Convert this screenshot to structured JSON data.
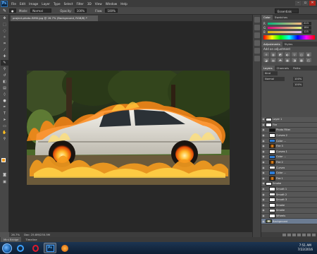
{
  "app": {
    "logo": "Ps",
    "menu": [
      "File",
      "Edit",
      "Image",
      "Layer",
      "Type",
      "Select",
      "Filter",
      "3D",
      "View",
      "Window",
      "Help"
    ],
    "window_controls": [
      "–",
      "▫",
      "✕"
    ]
  },
  "options_bar": {
    "mode_label": "Mode:",
    "mode_value": "Normal",
    "opacity_label": "Opacity:",
    "opacity_value": "100%",
    "flow_label": "Flow:",
    "flow_value": "100%",
    "workspace": "Essentials"
  },
  "document": {
    "tab_title": "project-photo-SIM0.jpg @ 26.7% (Background, RGB/8) *",
    "zoom": "26.7%",
    "doc_size": "Doc: 25.8M/230.5M"
  },
  "bottom_tabs": [
    "Mini Bridge",
    "Timeline"
  ],
  "color_panel": {
    "tabs": [
      "Color",
      "Swatches"
    ],
    "rows": [
      {
        "label": "R",
        "value": "223"
      },
      {
        "label": "G",
        "value": "184"
      },
      {
        "label": "B",
        "value": "125"
      }
    ]
  },
  "adjustments_panel": {
    "tabs": [
      "Adjustments",
      "Styles"
    ],
    "title": "Add an adjustment",
    "row1": [
      "☼",
      "▥",
      "◩",
      "◐",
      "▽",
      "◫",
      "◧"
    ],
    "row2": [
      "◪",
      "▤",
      "◓",
      "▦",
      "◨",
      "▩",
      "◰"
    ]
  },
  "layers_panel": {
    "tabs": [
      "Layers",
      "Channels",
      "Paths"
    ],
    "kind_label": "Kind",
    "blend_mode": "Normal",
    "opacity": "100%",
    "fill": "100%",
    "layers": [
      {
        "name": "Layer 1",
        "thumb": "white",
        "indent": false,
        "selected": false
      },
      {
        "name": "Fire",
        "thumb": "white",
        "indent": false,
        "selected": false
      },
      {
        "name": "Photo Filter",
        "thumb": "black",
        "indent": true,
        "selected": false
      },
      {
        "name": "Curves 2",
        "thumb": "white",
        "indent": true,
        "selected": false
      },
      {
        "name": "Color ...",
        "thumb": "blue",
        "indent": true,
        "selected": false
      },
      {
        "name": "Fire 3",
        "thumb": "fire",
        "indent": true,
        "selected": false
      },
      {
        "name": "Curves 1",
        "thumb": "white",
        "indent": true,
        "selected": false
      },
      {
        "name": "Color ...",
        "thumb": "blue",
        "indent": true,
        "selected": false
      },
      {
        "name": "Fire 2",
        "thumb": "fire",
        "indent": true,
        "selected": false
      },
      {
        "name": "Curves",
        "thumb": "white",
        "indent": true,
        "selected": false
      },
      {
        "name": "Color ...",
        "thumb": "blue",
        "indent": true,
        "selected": false
      },
      {
        "name": "Fire 1",
        "thumb": "fire",
        "indent": true,
        "selected": false
      },
      {
        "name": "Smoke",
        "thumb": "white",
        "indent": false,
        "selected": false
      },
      {
        "name": "Smudt 1",
        "thumb": "white",
        "indent": true,
        "selected": false
      },
      {
        "name": "Smudt 2",
        "thumb": "white",
        "indent": true,
        "selected": false
      },
      {
        "name": "Smudt 3",
        "thumb": "white",
        "indent": true,
        "selected": false
      },
      {
        "name": "Smoke",
        "thumb": "white",
        "indent": true,
        "selected": false
      },
      {
        "name": "Smoke",
        "thumb": "white",
        "indent": true,
        "selected": false
      },
      {
        "name": "Wheels",
        "thumb": "white",
        "indent": true,
        "selected": false
      },
      {
        "name": "Background",
        "thumb": "photo",
        "indent": false,
        "selected": true
      }
    ]
  },
  "clock": {
    "time": "7:51 AM",
    "date": "7/22/2016"
  },
  "colors": {
    "foreground": "#f19b1c",
    "background": "#ffffff"
  }
}
